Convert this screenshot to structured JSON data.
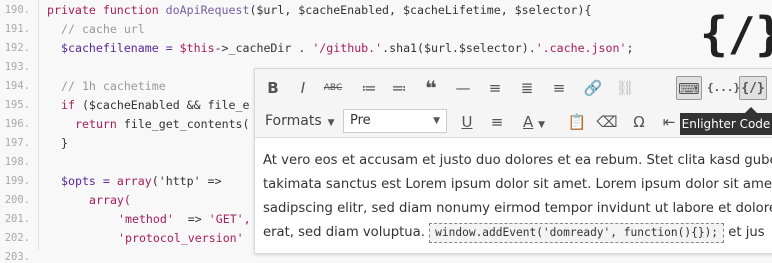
{
  "line_numbers": [
    "190.",
    "191.",
    "192.",
    "193.",
    "194.",
    "195.",
    "196.",
    "197.",
    "198.",
    "199.",
    "200.",
    "201.",
    "202.",
    "203."
  ],
  "code": {
    "l190_kw": "private function",
    "l190_fn": "doApiRequest",
    "l190_rest": "($url, $cacheEnabled, $cacheLifetime, $selector){",
    "l191": "// cache url",
    "l192_a": "$cachefilename = ",
    "l192_b": "$this",
    "l192_c": "->_cacheDir . ",
    "l192_d": "'/github.'",
    "l192_e": ".sha1($url.$selector).",
    "l192_f": "'.cache.json'",
    "l192_g": ";",
    "l194": "// 1h cachetime",
    "l195_kw": "if",
    "l195_rest": " ($cacheEnabled && file_e",
    "l196_kw": "return",
    "l196_rest": " file_get_contents(",
    "l197": "}",
    "l199_a": "$opts = ",
    "l199_b": "array",
    "l199_c": "('http' =>",
    "l200": "array(",
    "l201_a": "'method'",
    "l201_b": "  => ",
    "l201_c": "'GET',",
    "l202_a": "'protocol_version'",
    "l203": "'..."
  },
  "logo": "{/}",
  "editor": {
    "toolbar1": [
      "B",
      "I",
      "ABC",
      "≔",
      "≕",
      "❝",
      "—",
      "≡",
      "≣",
      "≡",
      "🔗",
      "⛓",
      "⌨",
      "{...}",
      "{/}"
    ],
    "formats_label": "Formats",
    "block_select": "Pre",
    "content_line1": "At vero eos et accusam et justo duo dolores et ea rebum. Stet clita kasd guberg",
    "content_line2": "takimata sanctus est Lorem ipsum dolor sit amet. Lorem ipsum dolor sit amet,",
    "content_line3": "sadipscing elitr, sed diam nonumy eirmod tempor invidunt ut labore et dolore",
    "content_line4_before": "erat, sed diam voluptua.",
    "inline_code": "window.addEvent('domready', function(){});",
    "content_line4_after": "et jus"
  },
  "tooltip": "Enlighter Code",
  "colors": {
    "keyword": "#a71d5d",
    "comment": "#999999",
    "function": "#795da3"
  }
}
